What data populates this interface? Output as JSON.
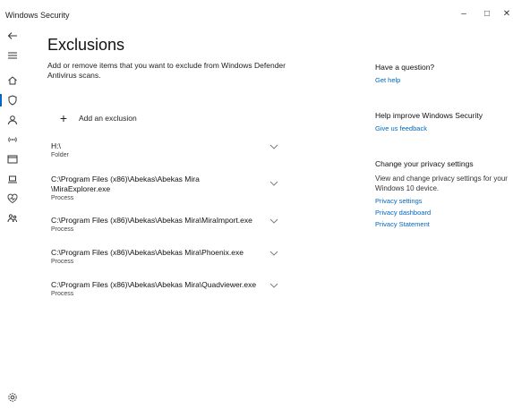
{
  "window": {
    "title": "Windows Security",
    "minimize": "–",
    "maximize": "□",
    "close": "✕"
  },
  "page": {
    "title": "Exclusions",
    "description": "Add or remove items that you want to exclude from Windows Defender Antivirus scans.",
    "add_label": "Add an exclusion"
  },
  "exclusions": [
    {
      "path": "H:\\",
      "type": "Folder"
    },
    {
      "path": "C:\\Program Files (x86)\\Abekas\\Abekas Mira \\MiraExplorer.exe",
      "type": "Process"
    },
    {
      "path": "C:\\Program Files (x86)\\Abekas\\Abekas Mira\\MiraImport.exe",
      "type": "Process"
    },
    {
      "path": "C:\\Program Files (x86)\\Abekas\\Abekas Mira\\Phoenix.exe",
      "type": "Process"
    },
    {
      "path": "C:\\Program Files (x86)\\Abekas\\Abekas Mira\\Quadviewer.exe",
      "type": "Process"
    }
  ],
  "sidebar": {
    "question": {
      "heading": "Have a question?",
      "link": "Get help"
    },
    "improve": {
      "heading": "Help improve Windows Security",
      "link": "Give us feedback"
    },
    "privacy": {
      "heading": "Change your privacy settings",
      "text": "View and change privacy settings for your Windows 10 device.",
      "links": [
        "Privacy settings",
        "Privacy dashboard",
        "Privacy Statement"
      ]
    }
  },
  "colors": {
    "accent": "#0067c0"
  },
  "nav_icons": [
    "back-icon",
    "menu-icon",
    "home-icon",
    "shield-icon",
    "account-icon",
    "wifi-icon",
    "app-browser-icon",
    "device-icon",
    "health-icon",
    "family-icon",
    "settings-icon"
  ]
}
